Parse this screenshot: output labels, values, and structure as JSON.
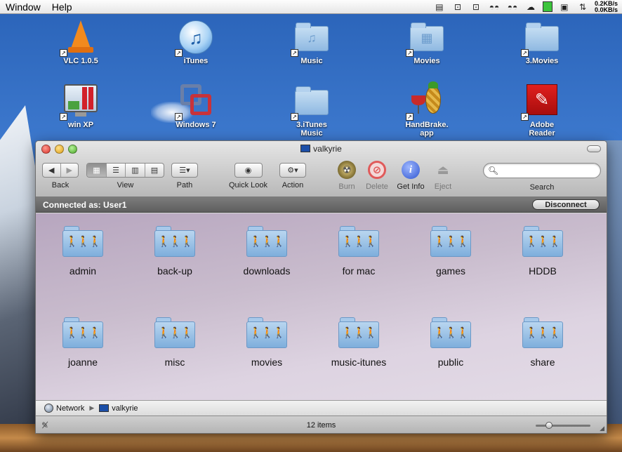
{
  "menubar": {
    "items": [
      "Window",
      "Help"
    ],
    "net_up": "0.2KB/s",
    "net_down": "0.0KB/s"
  },
  "desktop_icons": [
    {
      "label": "VLC 1.0.5",
      "icon": "vlc-cone-icon"
    },
    {
      "label": "iTunes",
      "icon": "itunes-icon"
    },
    {
      "label": "Music",
      "icon": "music-folder-icon"
    },
    {
      "label": "Movies",
      "icon": "movies-folder-icon"
    },
    {
      "label": "3.Movies",
      "icon": "folder-icon"
    },
    {
      "label": "win XP",
      "icon": "parallels-icon"
    },
    {
      "label": "Windows 7",
      "icon": "vmware-icon"
    },
    {
      "label": "3.iTunes\nMusic",
      "icon": "folder-icon"
    },
    {
      "label": "HandBrake.\napp",
      "icon": "handbrake-icon"
    },
    {
      "label": "Adobe\nReader",
      "icon": "adobe-reader-icon"
    }
  ],
  "window": {
    "title": "valkyrie",
    "toolbar": {
      "back": "Back",
      "view": "View",
      "path": "Path",
      "quick_look": "Quick Look",
      "action": "Action",
      "burn": "Burn",
      "delete": "Delete",
      "get_info": "Get Info",
      "eject": "Eject",
      "search": "Search",
      "search_placeholder": ""
    },
    "connection": {
      "text": "Connected as: User1",
      "disconnect": "Disconnect"
    },
    "shares": [
      "admin",
      "back-up",
      "downloads",
      "for mac",
      "games",
      "HDDB",
      "joanne",
      "misc",
      "movies",
      "music-itunes",
      "public",
      "share"
    ],
    "path": [
      "Network",
      "valkyrie"
    ],
    "status": "12 items",
    "icon_size_level": 0.2
  },
  "colors": {
    "accent": "#3a6fd0",
    "connbar": "#6a6a6a"
  }
}
